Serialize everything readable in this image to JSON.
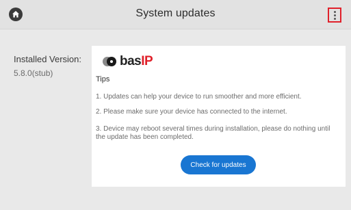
{
  "header": {
    "title": "System updates",
    "home_icon": "home-icon",
    "menu_icon": "more-vert-icon",
    "highlight_color": "#e0202a"
  },
  "sidebar": {
    "installed_label": "Installed Version:",
    "installed_value": "5.8.0(stub)"
  },
  "card": {
    "logo": {
      "part1": "bas",
      "part2": "IP"
    },
    "tips_title": "Tips",
    "tips": [
      "1. Updates can help your device to run smoother and more efficient.",
      "2. Please make sure your device has connected to the internet.",
      "3. Device may reboot several times during installation, please do nothing until the update has been completed."
    ],
    "button_label": "Check for updates",
    "button_color": "#1976d2"
  }
}
